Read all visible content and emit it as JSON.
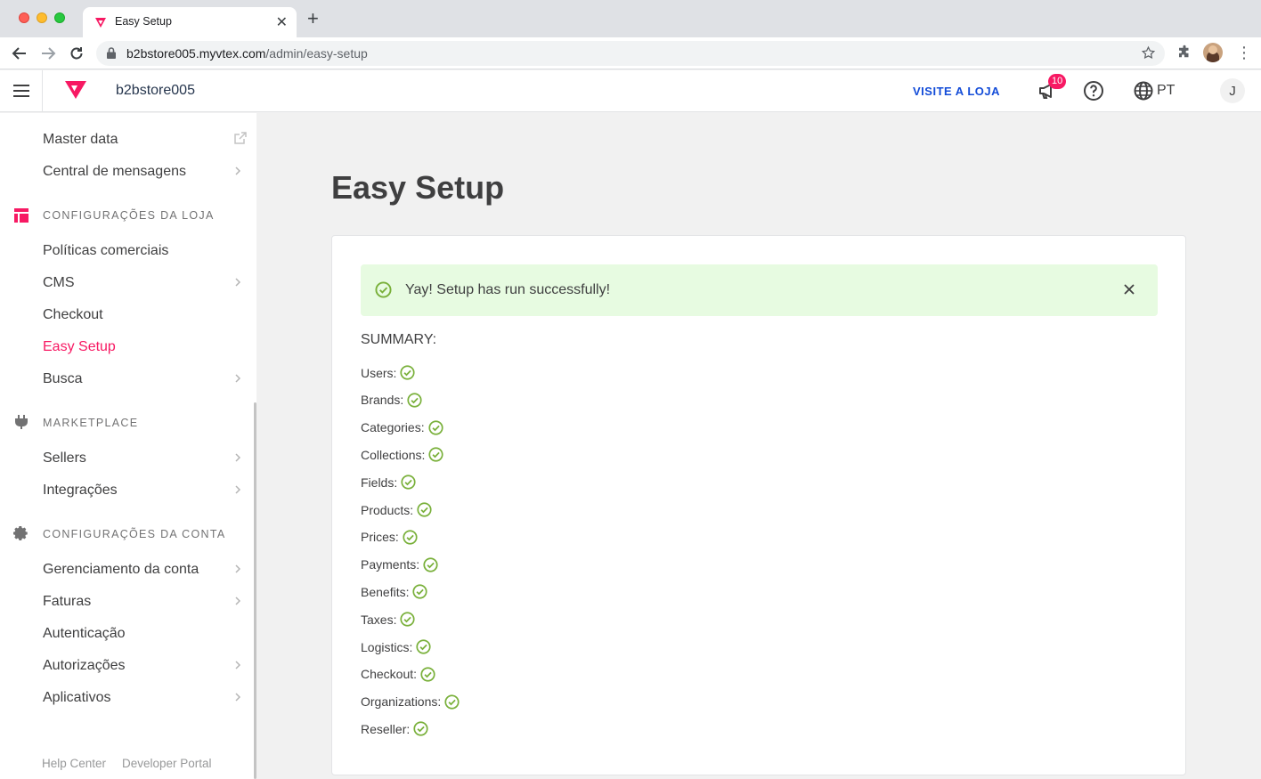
{
  "browser": {
    "tab_title": "Easy Setup",
    "url_host": "b2bstore005.myvtex.com",
    "url_path": "/admin/easy-setup"
  },
  "header": {
    "account": "b2bstore005",
    "visit_store": "VISITE A LOJA",
    "notifications_count": "10",
    "language": "PT",
    "user_initial": "J"
  },
  "sidebar": {
    "items_top": [
      {
        "label": "Master data"
      },
      {
        "label": "Central de mensagens"
      }
    ],
    "store_settings": {
      "title": "CONFIGURAÇÕES DA LOJA",
      "items": [
        {
          "label": "Políticas comerciais"
        },
        {
          "label": "CMS"
        },
        {
          "label": "Checkout"
        },
        {
          "label": "Easy Setup"
        },
        {
          "label": "Busca"
        }
      ]
    },
    "marketplace": {
      "title": "MARKETPLACE",
      "items": [
        {
          "label": "Sellers"
        },
        {
          "label": "Integrações"
        }
      ]
    },
    "account_settings": {
      "title": "CONFIGURAÇÕES DA CONTA",
      "items": [
        {
          "label": "Gerenciamento da conta"
        },
        {
          "label": "Faturas"
        },
        {
          "label": "Autenticação"
        },
        {
          "label": "Autorizações"
        },
        {
          "label": "Aplicativos"
        }
      ]
    },
    "footer": {
      "help_center": "Help Center",
      "developer_portal": "Developer Portal"
    }
  },
  "main": {
    "title": "Easy Setup",
    "alert_text": "Yay! Setup has run successfully!",
    "summary_title": "SUMMARY:",
    "summary_items": [
      {
        "label": "Users:"
      },
      {
        "label": "Brands:"
      },
      {
        "label": "Categories:"
      },
      {
        "label": "Collections:"
      },
      {
        "label": "Fields:"
      },
      {
        "label": "Products:"
      },
      {
        "label": "Prices:"
      },
      {
        "label": "Payments:"
      },
      {
        "label": "Benefits:"
      },
      {
        "label": "Taxes:"
      },
      {
        "label": "Logistics:"
      },
      {
        "label": "Checkout:"
      },
      {
        "label": "Organizations:"
      },
      {
        "label": "Reseller:"
      }
    ]
  },
  "colors": {
    "brand_pink": "#f71963",
    "link_blue": "#134cd8",
    "success_green": "#79b03a",
    "alert_bg": "#e7fbe1"
  }
}
